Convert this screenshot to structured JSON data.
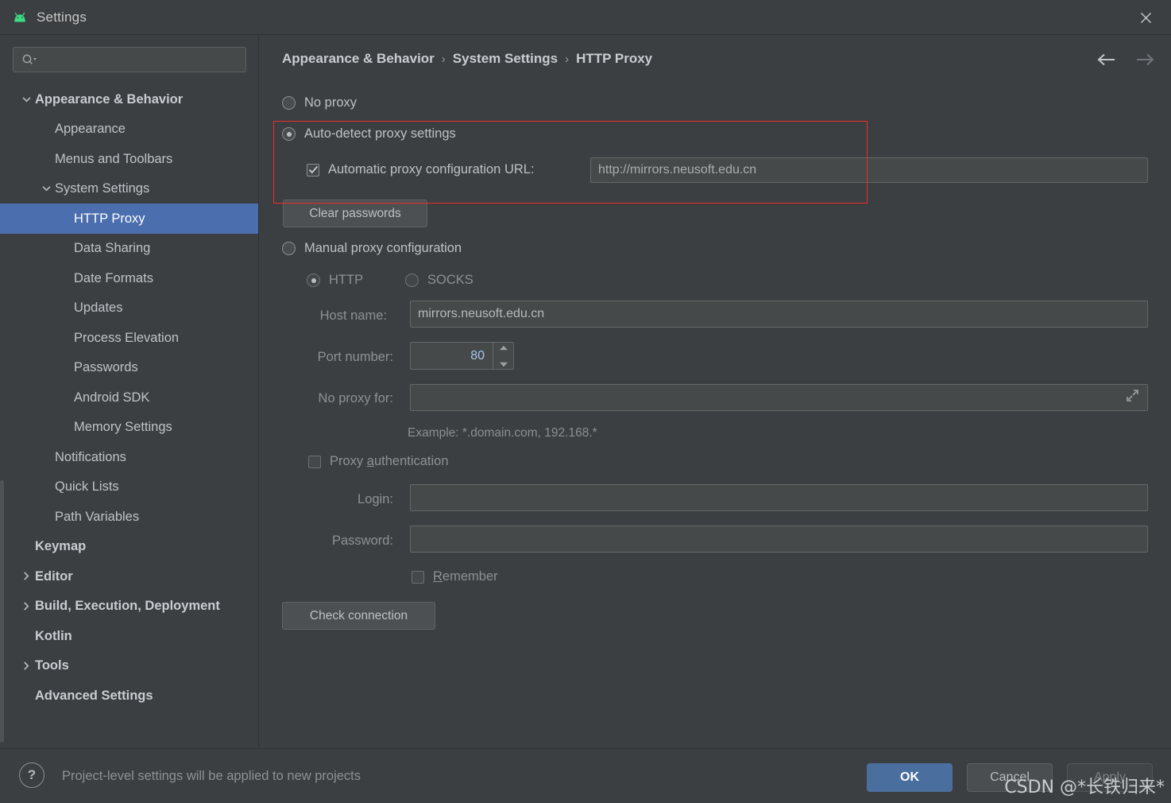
{
  "window": {
    "title": "Settings",
    "app_icon": "android-icon",
    "close_icon": "close-icon"
  },
  "sidebar": {
    "search": {
      "placeholder": "",
      "value": "",
      "icon": "search-icon"
    },
    "items": [
      {
        "label": "Appearance & Behavior",
        "level": 0,
        "bold": true,
        "arrow": "chevron-down",
        "selected": false
      },
      {
        "label": "Appearance",
        "level": 1,
        "bold": false,
        "arrow": "none",
        "selected": false
      },
      {
        "label": "Menus and Toolbars",
        "level": 1,
        "bold": false,
        "arrow": "none",
        "selected": false
      },
      {
        "label": "System Settings",
        "level": 1,
        "bold": false,
        "arrow": "chevron-down",
        "selected": false
      },
      {
        "label": "HTTP Proxy",
        "level": 2,
        "bold": false,
        "arrow": "none",
        "selected": true
      },
      {
        "label": "Data Sharing",
        "level": 2,
        "bold": false,
        "arrow": "none",
        "selected": false
      },
      {
        "label": "Date Formats",
        "level": 2,
        "bold": false,
        "arrow": "none",
        "selected": false
      },
      {
        "label": "Updates",
        "level": 2,
        "bold": false,
        "arrow": "none",
        "selected": false
      },
      {
        "label": "Process Elevation",
        "level": 2,
        "bold": false,
        "arrow": "none",
        "selected": false
      },
      {
        "label": "Passwords",
        "level": 2,
        "bold": false,
        "arrow": "none",
        "selected": false
      },
      {
        "label": "Android SDK",
        "level": 2,
        "bold": false,
        "arrow": "none",
        "selected": false
      },
      {
        "label": "Memory Settings",
        "level": 2,
        "bold": false,
        "arrow": "none",
        "selected": false
      },
      {
        "label": "Notifications",
        "level": 1,
        "bold": false,
        "arrow": "none",
        "selected": false
      },
      {
        "label": "Quick Lists",
        "level": 1,
        "bold": false,
        "arrow": "none",
        "selected": false
      },
      {
        "label": "Path Variables",
        "level": 1,
        "bold": false,
        "arrow": "none",
        "selected": false
      },
      {
        "label": "Keymap",
        "level": 0,
        "bold": true,
        "arrow": "none",
        "selected": false
      },
      {
        "label": "Editor",
        "level": 0,
        "bold": true,
        "arrow": "chevron-right",
        "selected": false
      },
      {
        "label": "Build, Execution, Deployment",
        "level": 0,
        "bold": true,
        "arrow": "chevron-right",
        "selected": false
      },
      {
        "label": "Kotlin",
        "level": 0,
        "bold": true,
        "arrow": "none",
        "selected": false
      },
      {
        "label": "Tools",
        "level": 0,
        "bold": true,
        "arrow": "chevron-right",
        "selected": false
      },
      {
        "label": "Advanced Settings",
        "level": 0,
        "bold": true,
        "arrow": "none",
        "selected": false
      }
    ]
  },
  "breadcrumb": {
    "part1": "Appearance & Behavior",
    "sep1": "›",
    "part2": "System Settings",
    "sep2": "›",
    "part3": "HTTP Proxy"
  },
  "nav": {
    "back_icon": "arrow-left-icon",
    "forward_icon": "arrow-right-icon"
  },
  "proxy": {
    "no_proxy_label": "No proxy",
    "no_proxy_checked": false,
    "auto_detect_label": "Auto-detect proxy settings",
    "auto_detect_checked": true,
    "pac_checkbox_label": "Automatic proxy configuration URL:",
    "pac_checked": true,
    "pac_url_value": "http://mirrors.neusoft.edu.cn",
    "clear_passwords_label": "Clear passwords",
    "manual_label": "Manual proxy configuration",
    "manual_checked": false,
    "http_label": "HTTP",
    "http_checked": true,
    "socks_label": "SOCKS",
    "socks_checked": false,
    "host_label": "Host name:",
    "host_value": "mirrors.neusoft.edu.cn",
    "port_label": "Port number:",
    "port_value": "80",
    "no_proxy_for_label": "No proxy for:",
    "no_proxy_for_value": "",
    "expand_icon": "expand-icon",
    "example_hint": "Example: *.domain.com, 192.168.*",
    "proxy_auth_label_pre": "Proxy ",
    "proxy_auth_label_mnemonic": "a",
    "proxy_auth_label_post": "uthentication",
    "proxy_auth_checked": false,
    "login_label": "Login:",
    "login_value": "",
    "password_label": "Password:",
    "password_value": "",
    "remember_label_mnemonic": "R",
    "remember_label_post": "emember",
    "remember_checked": false,
    "check_connection_label": "Check connection",
    "highlight_color": "#ef2b2b"
  },
  "footer": {
    "help_icon": "question-mark-icon",
    "note": "Project-level settings will be applied to new projects",
    "ok_label": "OK",
    "cancel_label": "Cancel",
    "apply_label": "Apply"
  },
  "watermark": {
    "text": "CSDN @*长铁归来*"
  },
  "colors": {
    "background": "#3c3f41",
    "selection": "#4b6eaf",
    "accent_ok": "#4a6f9e",
    "highlight": "#ef2b2b",
    "android_green": "#3ddc84"
  }
}
